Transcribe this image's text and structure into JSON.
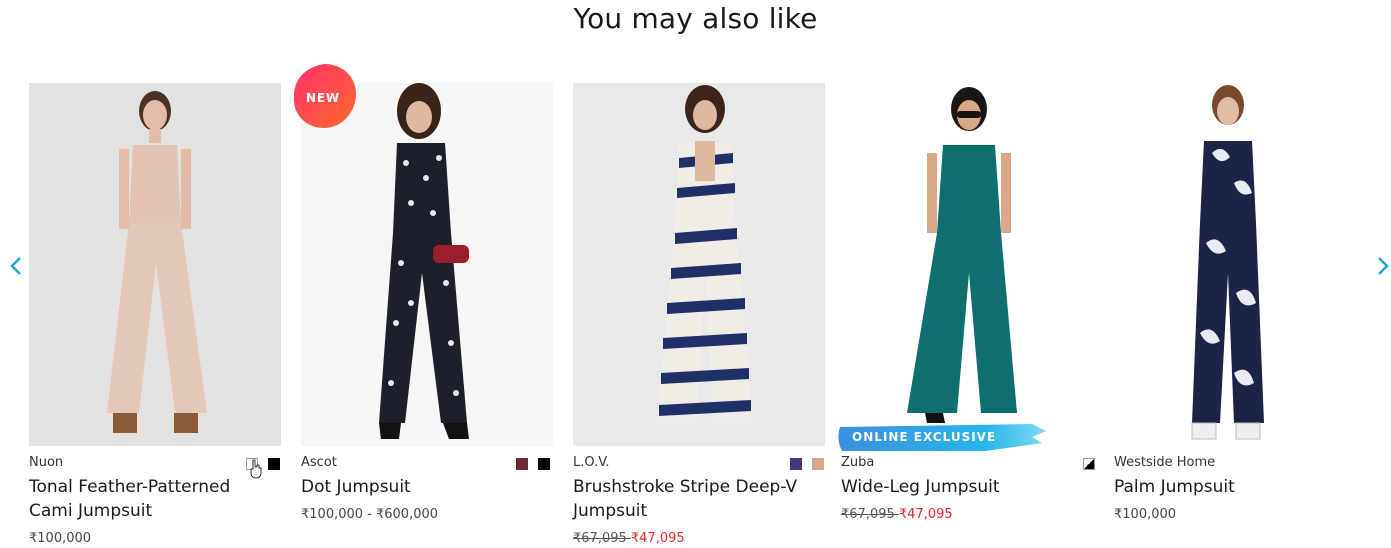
{
  "section": {
    "title": "You may also like"
  },
  "navigation": {
    "prev_icon": "chevron-left-icon",
    "next_icon": "chevron-right-icon",
    "accent": "#1ea7d6"
  },
  "badges": {
    "new": "NEW",
    "online_exclusive": "ONLINE EXCLUSIVE"
  },
  "products": [
    {
      "brand": "Nuon",
      "name_line1": "Tonal Feather-Patterned",
      "name_line2": "Cami Jumpsuit",
      "price": "₹100,000",
      "swatches": [
        "#ffffff",
        "#000000"
      ]
    },
    {
      "brand": "Ascot",
      "name_line1": "Dot Jumpsuit",
      "price": "₹100,000 - ₹600,000",
      "swatches": [
        "#6b2a2a",
        "#000000"
      ],
      "badge": "NEW"
    },
    {
      "brand": "L.O.V.",
      "name_line1": "Brushstroke Stripe Deep-V",
      "name_line2": "Jumpsuit",
      "price_old": "₹67,095 ",
      "price_new": "₹47,095",
      "swatches": [
        "#3e3f7a",
        "#d6a58c"
      ]
    },
    {
      "brand": "Zuba",
      "name_line1": "Wide-Leg Jumpsuit",
      "price_old": "₹67,095 ",
      "price_new": "₹47,095",
      "badge": "ONLINE EXCLUSIVE"
    },
    {
      "brand": "Westside Home",
      "name_line1": "Palm Jumpsuit",
      "price": "₹100,000",
      "swatches": [
        "#000000/#ffffff"
      ]
    }
  ]
}
